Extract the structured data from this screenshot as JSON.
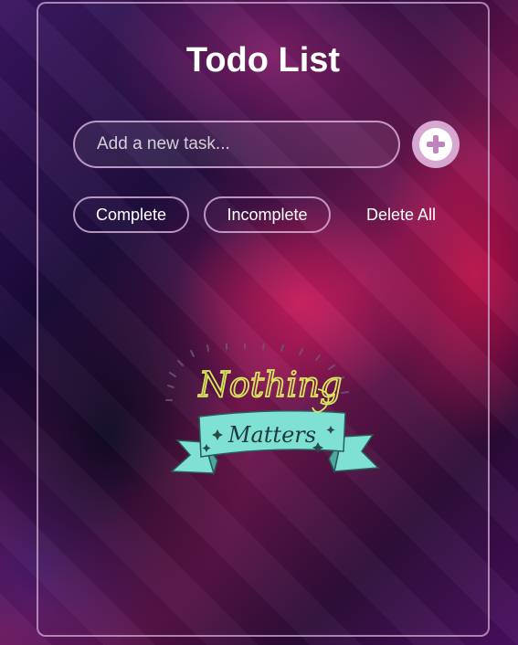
{
  "app": {
    "title": "Todo List"
  },
  "task_input": {
    "placeholder": "Add a new task...",
    "value": ""
  },
  "add_button": {
    "icon": "plus-circle-icon"
  },
  "filters": {
    "complete_label": "Complete",
    "incomplete_label": "Incomplete",
    "delete_all_label": "Delete All"
  },
  "empty_state": {
    "text_line1": "Nothing",
    "text_line2": "Matters"
  },
  "colors": {
    "accent": "#d6a7d0",
    "border": "#d2aad2",
    "banner": "#7fe0d4",
    "lettering": "#d8e85a"
  }
}
